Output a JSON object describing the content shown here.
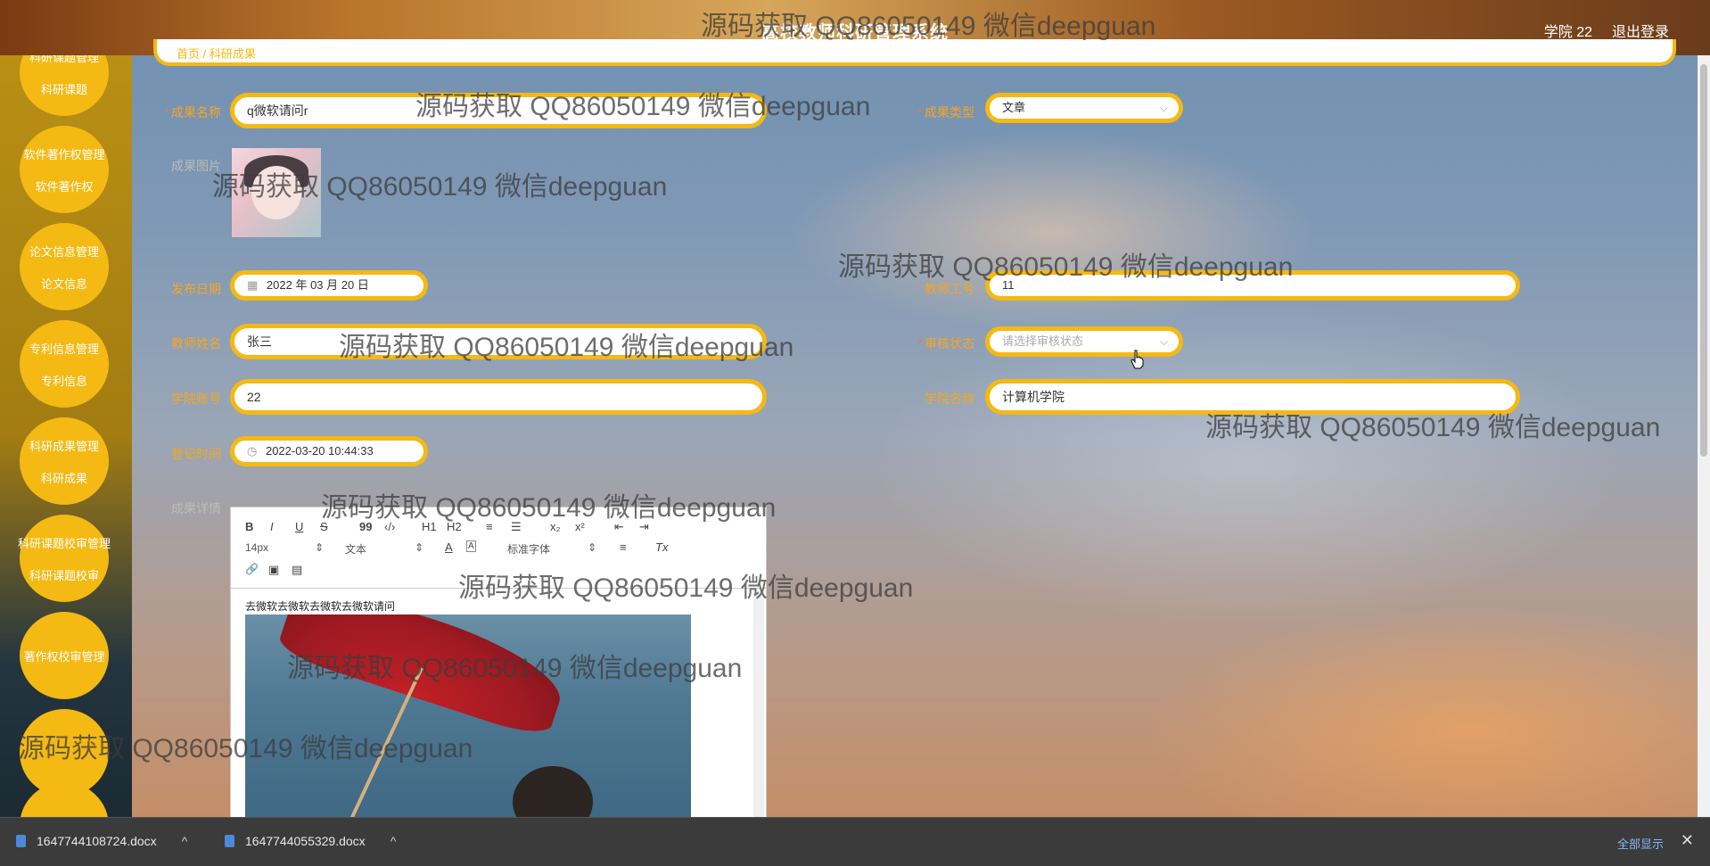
{
  "header": {
    "title": "高校教师科研管理系统",
    "user_label": "学院 22",
    "logout_label": "退出登录"
  },
  "sidebar": {
    "items": [
      {
        "label": "科研课题管理",
        "sub": "科研课题"
      },
      {
        "label": "软件著作权管理",
        "sub": "软件著作权"
      },
      {
        "label": "论文信息管理",
        "sub": "论文信息"
      },
      {
        "label": "专利信息管理",
        "sub": "专利信息"
      },
      {
        "label": "科研成果管理",
        "sub": "科研成果"
      },
      {
        "label": "科研课题校审管理",
        "sub": "科研课题校审"
      },
      {
        "label": "著作权校审管理",
        "sub": ""
      },
      {
        "label": "",
        "sub": ""
      },
      {
        "label": "",
        "sub": ""
      }
    ]
  },
  "breadcrumb": {
    "text": "首页 / 科研成果"
  },
  "form": {
    "name_label": "成果名称",
    "name_value": "q微软请问r",
    "type_label": "成果类型",
    "type_value": "文章",
    "image_label": "成果图片",
    "date_label": "发布日期",
    "date_value": "2022 年 03 月 20 日",
    "teacher_no_label": "教师工号",
    "teacher_no_value": "11",
    "teacher_name_label": "教师姓名",
    "teacher_name_value": "张三",
    "review_label": "审核状态",
    "review_placeholder": "请选择审核状态",
    "college_no_label": "学院账号",
    "college_no_value": "22",
    "college_name_label": "学院名称",
    "college_name_value": "计算机学院",
    "register_label": "登记时间",
    "register_value": "2022-03-20 10:44:33",
    "detail_label": "成果详情"
  },
  "editor": {
    "toolbar": {
      "bold": "B",
      "italic": "I",
      "underline": "U",
      "strike": "S",
      "quote": "99",
      "code": "‹/›",
      "h1": "H1",
      "h2": "H2",
      "ol": "≡",
      "ul": "☰",
      "sub": "x₂",
      "sup": "x²",
      "outdent": "⇤",
      "indent": "⇥",
      "size": "14px",
      "format": "文本",
      "color": "A",
      "bg": "A",
      "font": "标准字体",
      "align": "≡",
      "clear": "Tx",
      "link": "🔗",
      "image": "▣",
      "video": "▤"
    },
    "content_text": "去微软去微软去微软去微软请问"
  },
  "watermark": "源码获取 QQ86050149 微信deepguan",
  "downloads": [
    {
      "name": "1647744108724.docx"
    },
    {
      "name": "1647744055329.docx"
    }
  ],
  "download_bar": {
    "show_all": "全部显示",
    "close": "✕"
  },
  "colors": {
    "accent": "#f4b913",
    "label": "#f5a623"
  }
}
